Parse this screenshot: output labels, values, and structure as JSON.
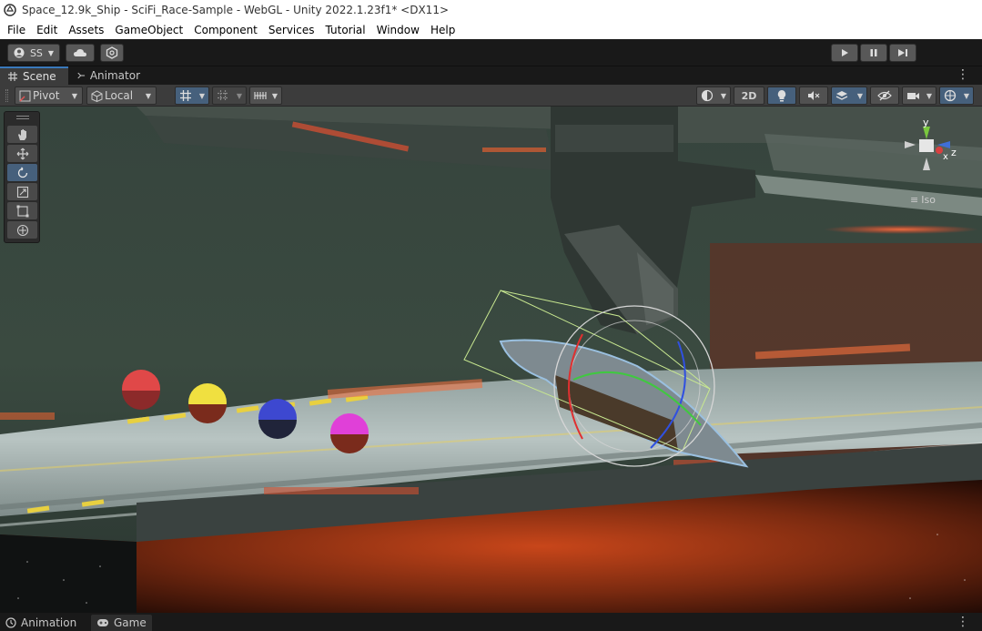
{
  "window": {
    "title": "Space_12.9k_Ship - SciFi_Race-Sample - WebGL - Unity 2022.1.23f1* <DX11>"
  },
  "menu": [
    "File",
    "Edit",
    "Assets",
    "GameObject",
    "Component",
    "Services",
    "Tutorial",
    "Window",
    "Help"
  ],
  "toolbar": {
    "account_label": "SS",
    "play_icon": "play-icon",
    "pause_icon": "pause-icon",
    "step_icon": "step-icon"
  },
  "tabs": {
    "scene": "Scene",
    "animator": "Animator"
  },
  "scene_toolbar": {
    "pivot": "Pivot",
    "local": "Local",
    "mode_2d": "2D"
  },
  "gizmo": {
    "y": "y",
    "z": "z",
    "x": "x",
    "projection": "Iso"
  },
  "bottom_tabs": {
    "animation": "Animation",
    "game": "Game"
  },
  "colors": {
    "accent": "#3a79bb",
    "selected_tool": "#46607c",
    "panel": "#3c3c3c",
    "toolbar": "#191919"
  }
}
